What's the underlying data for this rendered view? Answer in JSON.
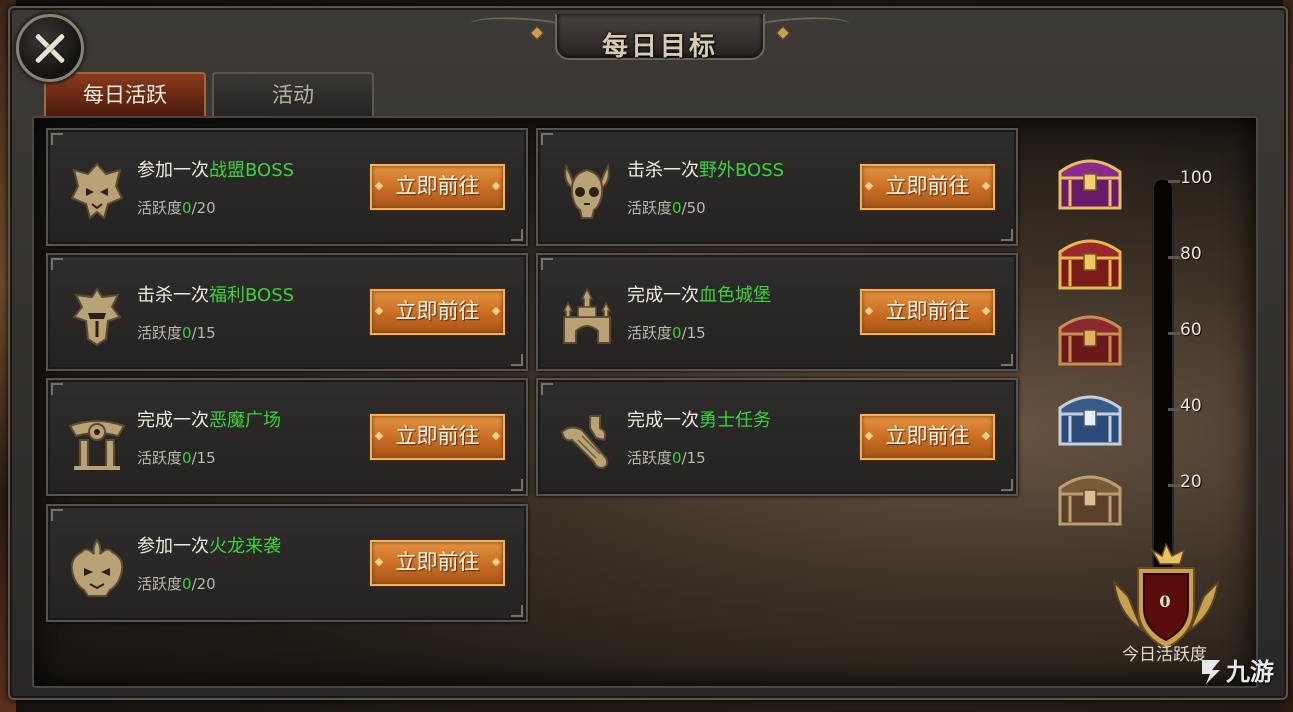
{
  "window": {
    "title": "每日目标"
  },
  "tabs": [
    {
      "label": "每日活跃",
      "active": true
    },
    {
      "label": "活动",
      "active": false
    }
  ],
  "quests": [
    {
      "prefix": "参加一次",
      "target": "战盟BOSS",
      "progress_label": "活跃度",
      "current": "0",
      "max": "/20",
      "button": "立即前往",
      "icon": "demon-mask-icon"
    },
    {
      "prefix": "击杀一次",
      "target": "野外BOSS",
      "progress_label": "活跃度",
      "current": "0",
      "max": "/50",
      "button": "立即前往",
      "icon": "horned-skull-icon"
    },
    {
      "prefix": "击杀一次",
      "target": "福利BOSS",
      "progress_label": "活跃度",
      "current": "0",
      "max": "/15",
      "button": "立即前往",
      "icon": "knight-helmet-icon"
    },
    {
      "prefix": "完成一次",
      "target": "血色城堡",
      "progress_label": "活跃度",
      "current": "0",
      "max": "/15",
      "button": "立即前往",
      "icon": "castle-icon"
    },
    {
      "prefix": "完成一次",
      "target": "恶魔广场",
      "progress_label": "活跃度",
      "current": "0",
      "max": "/15",
      "button": "立即前往",
      "icon": "demon-gate-icon"
    },
    {
      "prefix": "完成一次",
      "target": "勇士任务",
      "progress_label": "活跃度",
      "current": "0",
      "max": "/15",
      "button": "立即前往",
      "icon": "scroll-icon"
    },
    {
      "prefix": "参加一次",
      "target": "火龙来袭",
      "progress_label": "活跃度",
      "current": "0",
      "max": "/20",
      "button": "立即前往",
      "icon": "fire-dragon-icon"
    }
  ],
  "gauge": {
    "ticks": [
      "100",
      "80",
      "60",
      "40",
      "20"
    ],
    "value": "0",
    "max": 100,
    "caption": "今日活跃度",
    "fill_color": "#c83010"
  },
  "chests": [
    {
      "tier": "100",
      "icon": "purple-gold-chest-icon"
    },
    {
      "tier": "80",
      "icon": "red-gold-chest-icon"
    },
    {
      "tier": "60",
      "icon": "red-bronze-chest-icon"
    },
    {
      "tier": "40",
      "icon": "silver-blue-chest-icon"
    },
    {
      "tier": "20",
      "icon": "wooden-chest-icon"
    }
  ],
  "watermark": {
    "text": "九游"
  },
  "colors": {
    "highlight": "#39d439",
    "button": "#c86c22",
    "tab_active": "#8a3a1c"
  }
}
